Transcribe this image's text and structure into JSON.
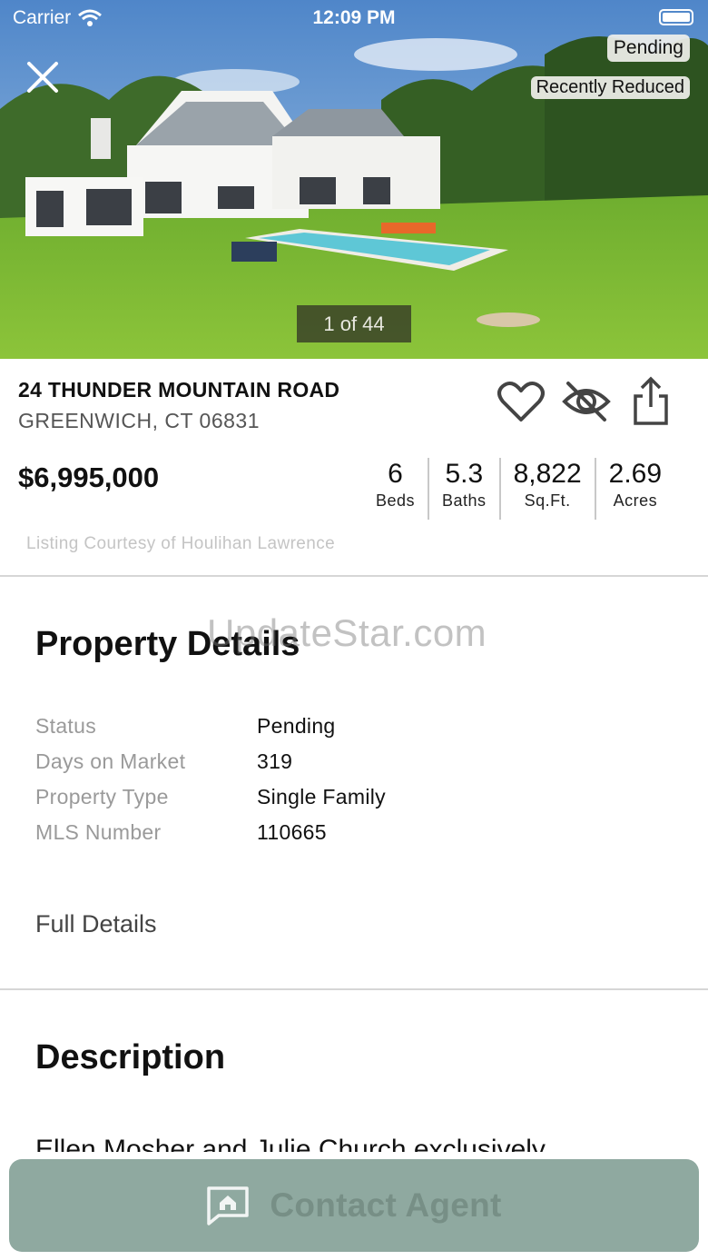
{
  "status_bar": {
    "carrier": "Carrier",
    "time": "12:09 PM"
  },
  "hero": {
    "badges": {
      "status": "Pending",
      "price_change": "Recently Reduced"
    },
    "photo_counter": "1 of 44"
  },
  "listing": {
    "address": "24 THUNDER MOUNTAIN ROAD",
    "city_line": "GREENWICH, CT 06831",
    "price": "$6,995,000",
    "stats": [
      {
        "value": "6",
        "label": "Beds"
      },
      {
        "value": "5.3",
        "label": "Baths"
      },
      {
        "value": "8,822",
        "label": "Sq.Ft."
      },
      {
        "value": "2.69",
        "label": "Acres"
      }
    ],
    "courtesy": "Listing Courtesy of Houlihan Lawrence"
  },
  "watermark": "UpdateStar.com",
  "property_details": {
    "title": "Property Details",
    "rows": [
      {
        "key": "Status",
        "value": "Pending"
      },
      {
        "key": "Days on Market",
        "value": "319"
      },
      {
        "key": "Property Type",
        "value": "Single Family"
      },
      {
        "key": "MLS Number",
        "value": "110665"
      }
    ],
    "full_details_link": "Full Details"
  },
  "description": {
    "title": "Description",
    "text": "Ellen Mosher and Julie Church exclusively"
  },
  "contact_button": {
    "label": "Contact Agent"
  },
  "icons": [
    "close-icon",
    "heart-icon",
    "hide-eye-icon",
    "share-icon",
    "chat-home-icon",
    "wifi-icon",
    "battery-icon"
  ]
}
